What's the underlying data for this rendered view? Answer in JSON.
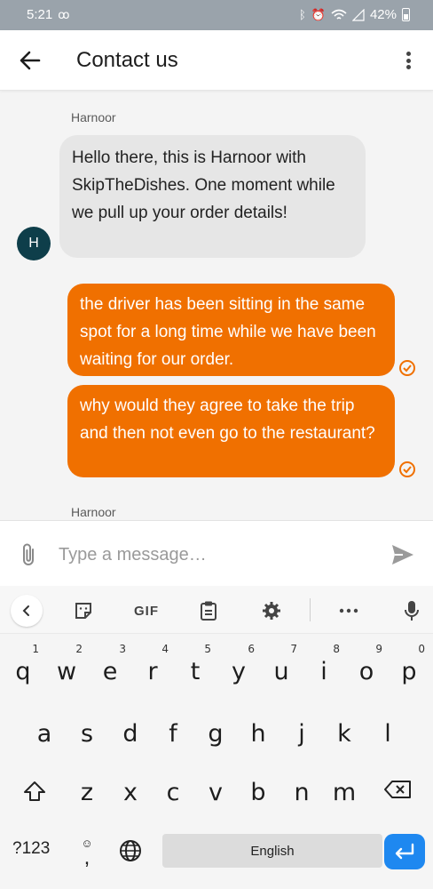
{
  "status_bar": {
    "time": "5:21",
    "battery": "42%"
  },
  "app_bar": {
    "title": "Contact us"
  },
  "chat": {
    "messages": [
      {
        "sender": "Harnoor",
        "avatar_initial": "H",
        "text": "Hello there, this is Harnoor with SkipTheDishes. One moment while we pull up your order details!"
      },
      {
        "sender": "",
        "text": "the driver has been sitting in the same spot for a long time while we have been waiting for our order."
      },
      {
        "sender": "",
        "text": "why would they agree to take the trip and then not even go to the restaurant?"
      },
      {
        "sender": "Harnoor"
      }
    ]
  },
  "composer": {
    "placeholder": "Type a message…"
  },
  "keyboard": {
    "toolbar": {
      "gif_label": "GIF"
    },
    "row1": [
      {
        "key": "q",
        "hint": "1"
      },
      {
        "key": "w",
        "hint": "2"
      },
      {
        "key": "e",
        "hint": "3"
      },
      {
        "key": "r",
        "hint": "4"
      },
      {
        "key": "t",
        "hint": "5"
      },
      {
        "key": "y",
        "hint": "6"
      },
      {
        "key": "u",
        "hint": "7"
      },
      {
        "key": "i",
        "hint": "8"
      },
      {
        "key": "o",
        "hint": "9"
      },
      {
        "key": "p",
        "hint": "0"
      }
    ],
    "row2": [
      "a",
      "s",
      "d",
      "f",
      "g",
      "h",
      "j",
      "k",
      "l"
    ],
    "row3": [
      "z",
      "x",
      "c",
      "v",
      "b",
      "n",
      "m"
    ],
    "symbols_label": "?123",
    "space_label": "English",
    "comma": ","
  },
  "colors": {
    "accent": "#f07000",
    "incoming_bubble": "#e6e6e6",
    "avatar": "#0e3e4a",
    "enter_key": "#1e88f0"
  }
}
